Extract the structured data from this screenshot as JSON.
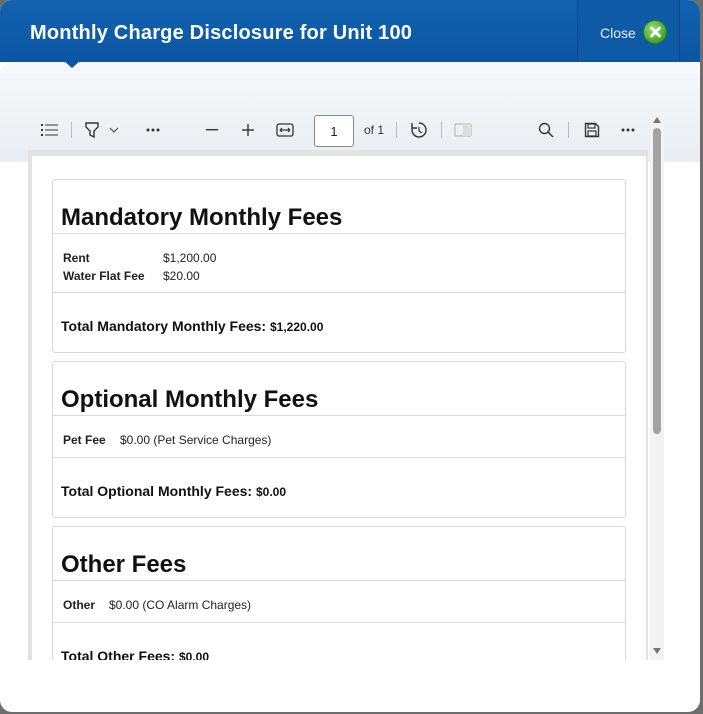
{
  "modal": {
    "title": "Monthly Charge Disclosure for Unit 100",
    "close_label": "Close"
  },
  "toolbar": {
    "page_current": "1",
    "page_total": "of 1"
  },
  "document": {
    "mandatory": {
      "heading": "Mandatory Monthly Fees",
      "items": [
        {
          "label": "Rent",
          "value": "$1,200.00"
        },
        {
          "label": "Water Flat Fee",
          "value": "$20.00"
        }
      ],
      "total_label": "Total Mandatory Monthly Fees:",
      "total_value": "$1,220.00"
    },
    "optional": {
      "heading": "Optional Monthly Fees",
      "items": [
        {
          "label": "Pet Fee",
          "value": "$0.00 (Pet Service Charges)"
        }
      ],
      "total_label": "Total Optional Monthly Fees:",
      "total_value": "$0.00"
    },
    "other": {
      "heading": "Other Fees",
      "items": [
        {
          "label": "Other",
          "value": "$0.00 (CO Alarm Charges)"
        }
      ],
      "total_label": "Total Other Fees:",
      "total_value": "$0.00"
    }
  }
}
